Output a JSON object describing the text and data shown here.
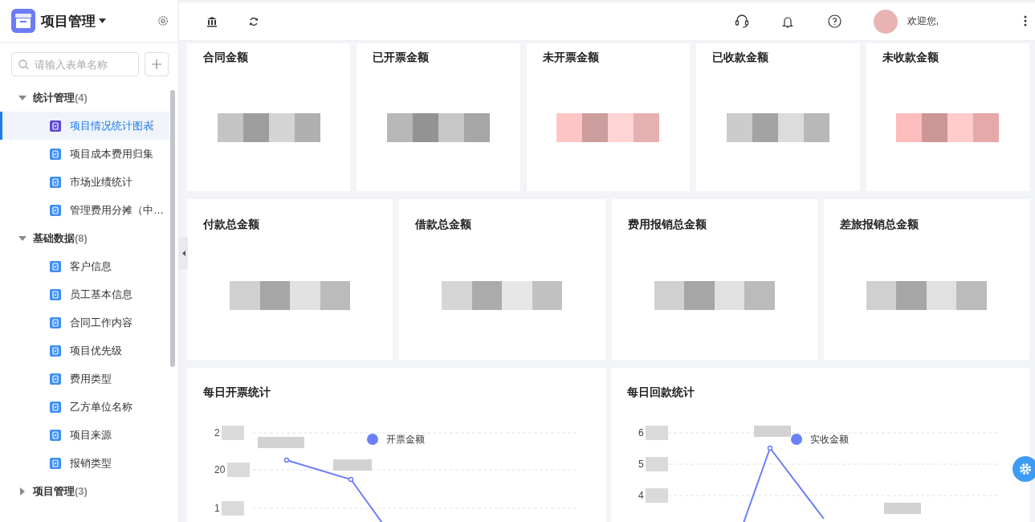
{
  "app": {
    "title": "项目管理"
  },
  "sidebar": {
    "search": {
      "placeholder": "请输入表单名称"
    },
    "groups": [
      {
        "label": "统计管理",
        "count": "(4)",
        "expanded": true,
        "children": [
          {
            "label": "项目情况统计图表",
            "selected": true
          },
          {
            "label": "项目成本费用归集",
            "selected": false
          },
          {
            "label": "市场业绩统计",
            "selected": false
          },
          {
            "label": "管理费用分摊（中…",
            "selected": false
          }
        ]
      },
      {
        "label": "基础数据",
        "count": "(8)",
        "expanded": true,
        "children": [
          {
            "label": "客户信息",
            "selected": false
          },
          {
            "label": "员工基本信息",
            "selected": false
          },
          {
            "label": "合同工作内容",
            "selected": false
          },
          {
            "label": "项目优先级",
            "selected": false
          },
          {
            "label": "费用类型",
            "selected": false
          },
          {
            "label": "乙方单位名称",
            "selected": false
          },
          {
            "label": "项目来源",
            "selected": false
          },
          {
            "label": "报销类型",
            "selected": false
          }
        ]
      },
      {
        "label": "项目管理",
        "count": "(3)",
        "expanded": false
      }
    ]
  },
  "header": {
    "greeting": "欢迎您,"
  },
  "summary_cards": [
    {
      "title": "合同金额",
      "masked": true,
      "color": "#c4c4c4"
    },
    {
      "title": "已开票金额",
      "masked": true,
      "color": "#b8b8b8"
    },
    {
      "title": "未开票金额",
      "masked": true,
      "color": "#ffc4c4"
    },
    {
      "title": "已收款金额",
      "masked": true,
      "color": "#cccccc"
    },
    {
      "title": "未收款金额",
      "masked": true,
      "color": "#ffbcbc"
    },
    {
      "title": "付款总金额",
      "masked": true,
      "color": "#d0d0d0"
    },
    {
      "title": "借款总金额",
      "masked": true,
      "color": "#d6d6d6"
    },
    {
      "title": "费用报销总金额",
      "masked": true,
      "color": "#d0d0d0"
    },
    {
      "title": "差旅报销总金额",
      "masked": true,
      "color": "#d0d0d0"
    }
  ],
  "charts": [
    {
      "title": "每日开票统计",
      "legend": "开票金额",
      "y_ticks": [
        "2",
        "20",
        "1"
      ]
    },
    {
      "title": "每日回款统计",
      "legend": "实收金额",
      "y_ticks": [
        "6",
        "5",
        "4"
      ]
    }
  ]
}
